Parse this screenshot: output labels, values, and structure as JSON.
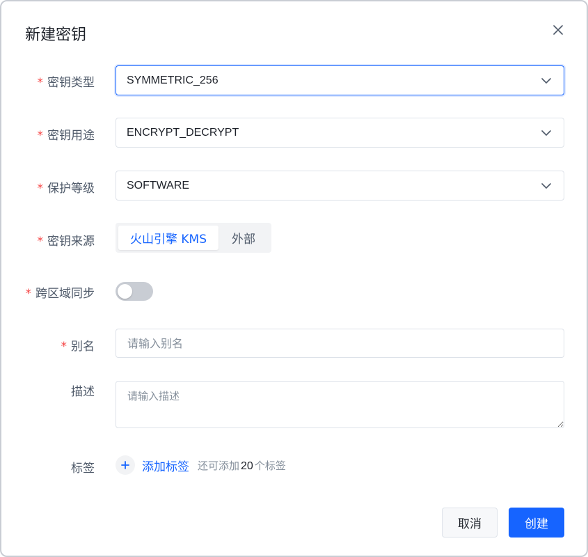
{
  "dialog": {
    "title": "新建密钥"
  },
  "form": {
    "key_spec": {
      "label": "密钥类型",
      "value": "SYMMETRIC_256"
    },
    "key_usage": {
      "label": "密钥用途",
      "value": "ENCRYPT_DECRYPT"
    },
    "protection_level": {
      "label": "保护等级",
      "value": "SOFTWARE"
    },
    "origin": {
      "label": "密钥来源",
      "options": [
        "火山引擎 KMS",
        "外部"
      ],
      "selected": "火山引擎 KMS"
    },
    "multi_region": {
      "label": "跨区域同步",
      "on": false
    },
    "alias": {
      "label": "别名",
      "placeholder": "请输入别名"
    },
    "description": {
      "label": "描述",
      "placeholder": "请输入描述"
    },
    "tags": {
      "label": "标签",
      "add_label": "添加标签",
      "hint_prefix": "还可添加",
      "remaining": "20",
      "hint_suffix": "个标签"
    }
  },
  "footer": {
    "cancel_label": "取消",
    "create_label": "创建"
  },
  "colors": {
    "primary": "#1664ff",
    "required": "#f53f3f"
  }
}
